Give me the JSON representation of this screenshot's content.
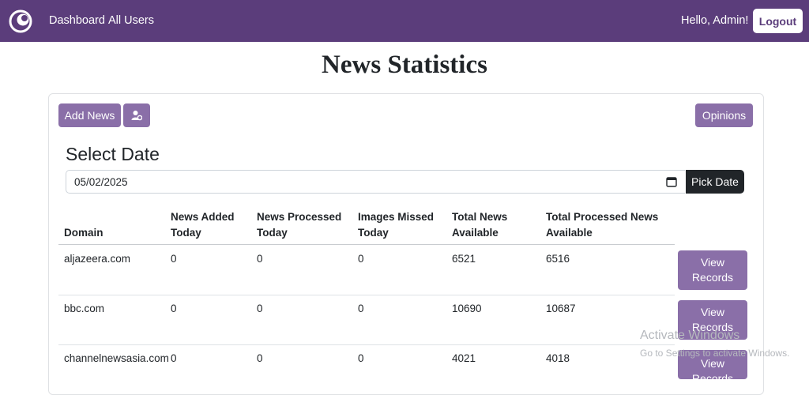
{
  "navbar": {
    "links": [
      "Dashboard",
      "All Users"
    ],
    "greeting": "Hello, Admin!",
    "logout_label": "Logout",
    "background_color": "#5b3d7b"
  },
  "page": {
    "title": "News Statistics"
  },
  "toolbar": {
    "add_news_label": "Add News",
    "add_user_icon": "user-gear-icon",
    "opinions_label": "Opinions",
    "button_color": "#8a6fa8"
  },
  "date_picker": {
    "heading": "Select Date",
    "value": "05/02/2025",
    "pick_label": "Pick Date"
  },
  "table": {
    "columns": [
      [
        "Domain"
      ],
      [
        "News Added",
        "Today"
      ],
      [
        "News Processed",
        "Today"
      ],
      [
        "Images Missed",
        "Today"
      ],
      [
        "Total News",
        "Available"
      ],
      [
        "Total Processed News",
        "Available"
      ]
    ],
    "rows": [
      {
        "domain": "aljazeera.com",
        "added": "0",
        "processed": "0",
        "missed": "0",
        "total": "6521",
        "total_processed": "6516",
        "action": [
          "View",
          "Records"
        ]
      },
      {
        "domain": "bbc.com",
        "added": "0",
        "processed": "0",
        "missed": "0",
        "total": "10690",
        "total_processed": "10687",
        "action": [
          "View",
          "Records"
        ]
      },
      {
        "domain": "channelnewsasia.com",
        "added": "0",
        "processed": "0",
        "missed": "0",
        "total": "4021",
        "total_processed": "4018",
        "action": [
          "View",
          "Records"
        ]
      }
    ]
  },
  "watermark": {
    "title": "Activate Windows",
    "subtitle": "Go to Settings to activate Windows."
  }
}
